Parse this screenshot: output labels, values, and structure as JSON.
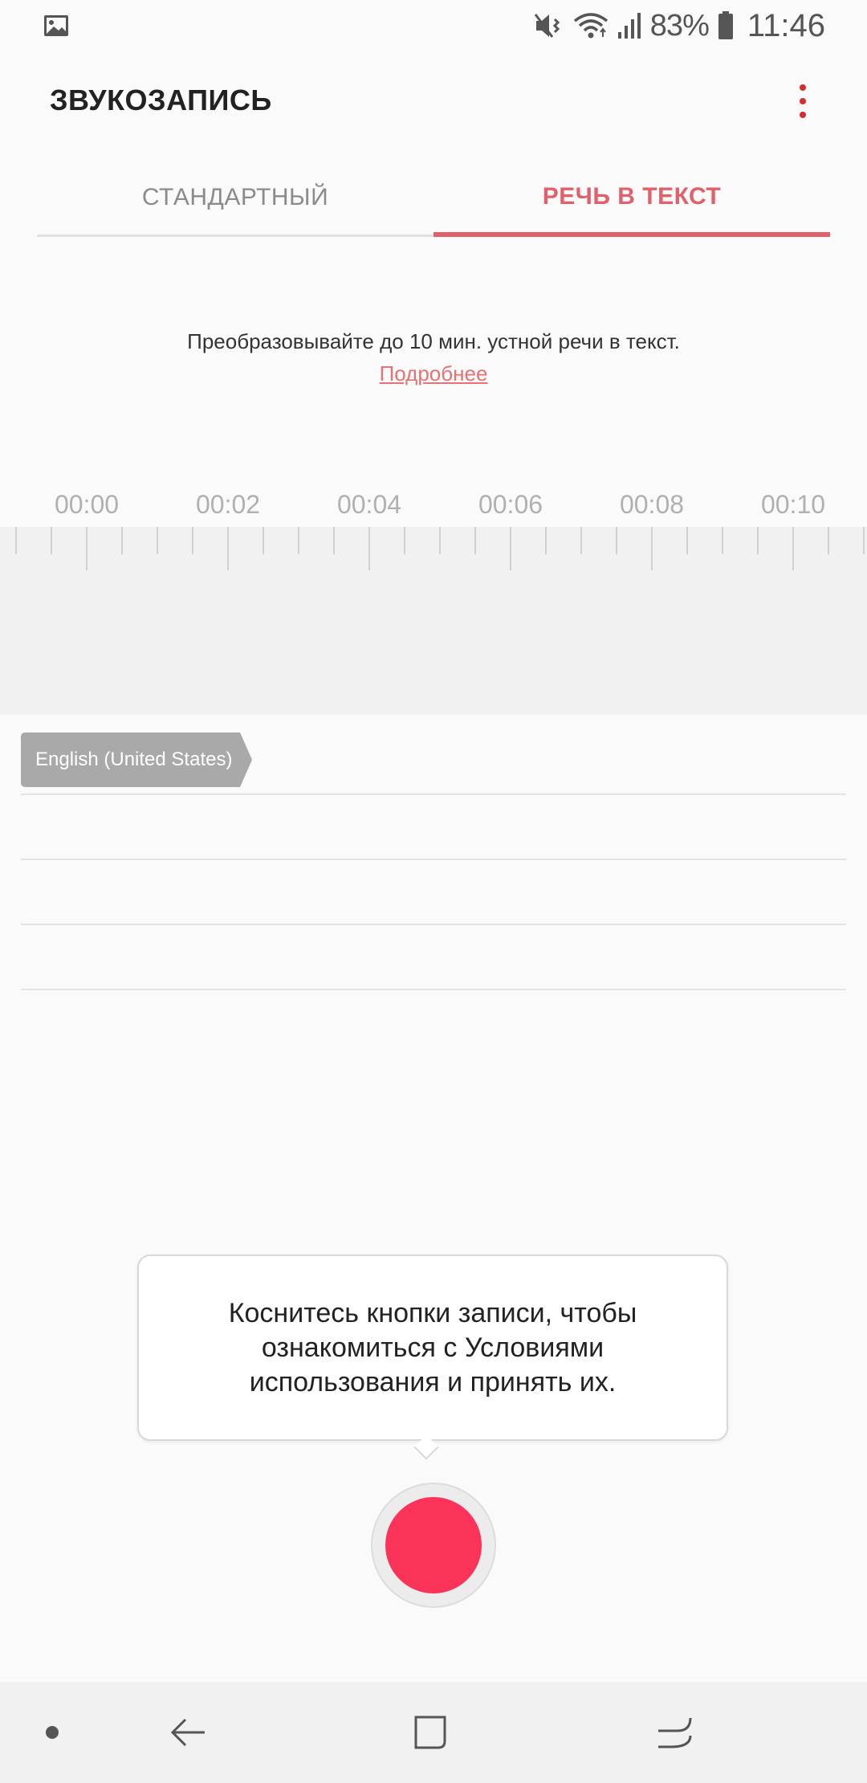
{
  "status_bar": {
    "battery_percent": "83%",
    "time": "11:46",
    "icons": [
      "gallery-icon",
      "mute-vibrate-icon",
      "wifi-icon",
      "signal-icon",
      "battery-icon"
    ]
  },
  "app_bar": {
    "title": "ЗВУКОЗАПИСЬ",
    "menu_icon": "more-vert-icon"
  },
  "tabs": [
    {
      "label": "СТАНДАРТНЫЙ",
      "selected": false
    },
    {
      "label": "РЕЧЬ В ТЕКСТ",
      "selected": true
    }
  ],
  "intro": {
    "text": "Преобразовывайте до 10 мин. устной речи в текст.",
    "link": "Подробнее"
  },
  "timeline": {
    "labels": [
      "00:00",
      "00:02",
      "00:04",
      "00:06",
      "00:08",
      "00:10"
    ]
  },
  "language_chip": "English (United States)",
  "tooltip": {
    "text": "Коснитесь кнопки записи, чтобы ознакомиться с Условиями использования и принять их."
  },
  "colors": {
    "accent": "#e0606b",
    "record": "#fb3358",
    "menu_dots": "#d32f2f"
  }
}
